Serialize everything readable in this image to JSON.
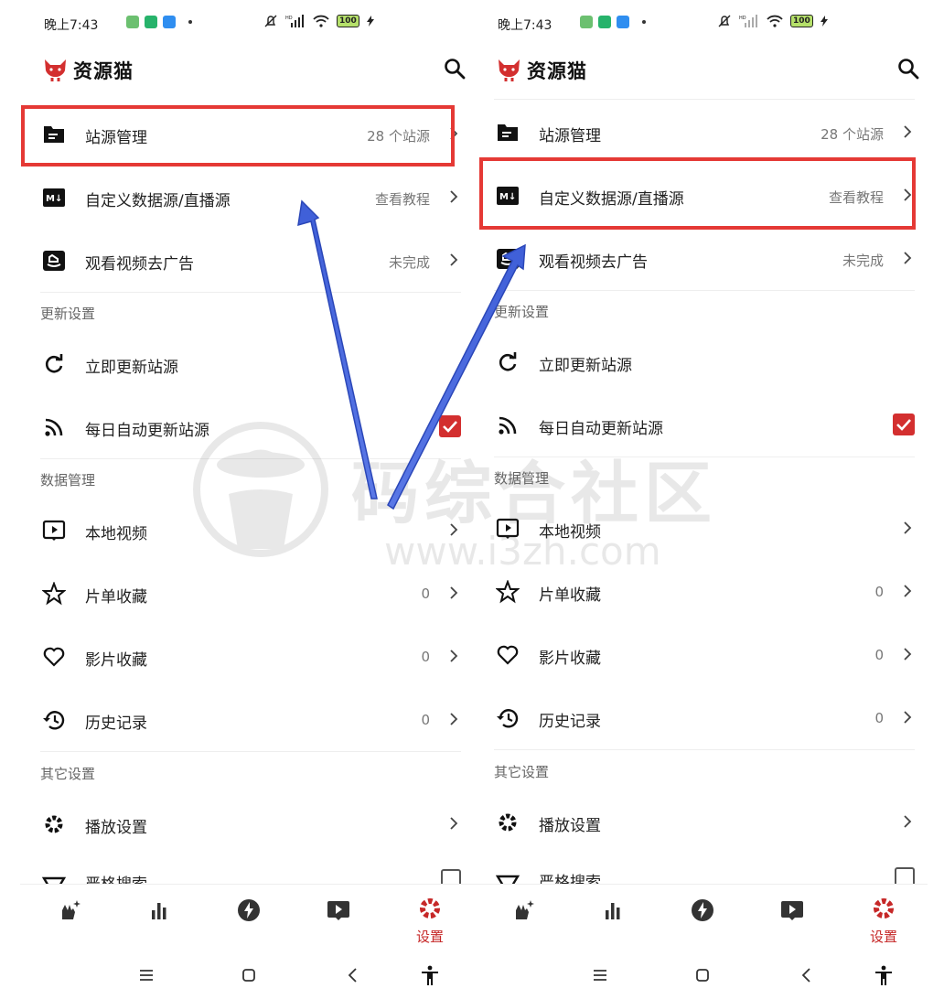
{
  "status": {
    "time": "晚上7:43",
    "battery": "100",
    "hd": "HD"
  },
  "app": {
    "title": "资源猫"
  },
  "rows": {
    "site_source": {
      "label": "站源管理",
      "value": "28 个站源"
    },
    "custom_source": {
      "label": "自定义数据源/直播源",
      "value": "查看教程"
    },
    "ad_removal": {
      "label": "观看视频去广告",
      "value": "未完成"
    },
    "update_now": {
      "label": "立即更新站源"
    },
    "daily_update": {
      "label": "每日自动更新站源",
      "checked": true
    },
    "local_video": {
      "label": "本地视频"
    },
    "playlist_fav": {
      "label": "片单收藏",
      "value": "0"
    },
    "movie_fav": {
      "label": "影片收藏",
      "value": "0"
    },
    "history": {
      "label": "历史记录",
      "value": "0"
    },
    "playback": {
      "label": "播放设置"
    },
    "strict_search": {
      "label": "严格搜索",
      "checked": false
    }
  },
  "sections": {
    "update": "更新设置",
    "data": "数据管理",
    "other": "其它设置"
  },
  "bottom_nav": {
    "settings_label": "设置",
    "active": "settings"
  },
  "watermark": {
    "text": "码综合社区",
    "url": "www.i3zh.com"
  },
  "colors": {
    "accent": "#c62828",
    "highlight": "#e53935",
    "arrow": "#3f5fd8"
  }
}
